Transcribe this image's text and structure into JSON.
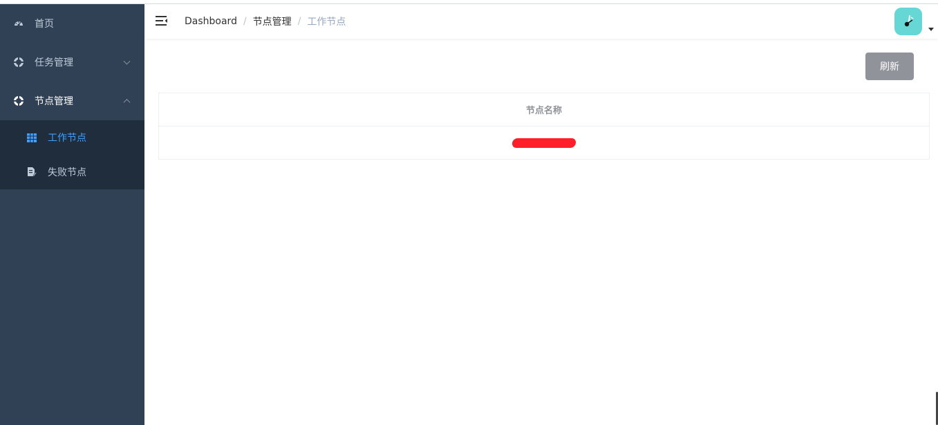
{
  "sidebar": {
    "items": [
      {
        "label": "首页",
        "icon": "dashboard-icon"
      },
      {
        "label": "任务管理",
        "icon": "lifebuoy-icon",
        "expanded": false
      },
      {
        "label": "节点管理",
        "icon": "lifebuoy-icon",
        "expanded": true,
        "children": [
          {
            "label": "工作节点",
            "icon": "table-icon",
            "active": true
          },
          {
            "label": "失败节点",
            "icon": "document-edit-icon",
            "active": false
          }
        ]
      }
    ]
  },
  "header": {
    "breadcrumb": [
      "Dashboard",
      "节点管理",
      "工作节点"
    ],
    "separator": "/"
  },
  "toolbar": {
    "refresh_label": "刷新"
  },
  "table": {
    "columns": [
      "节点名称"
    ],
    "rows": [
      [
        "[redacted]"
      ]
    ]
  },
  "colors": {
    "sidebar_bg": "#304156",
    "submenu_bg": "#1f2d3d",
    "active": "#409eff",
    "button_info": "#909399",
    "avatar_bg": "#67d7d6",
    "redaction": "#ff1f2a"
  }
}
